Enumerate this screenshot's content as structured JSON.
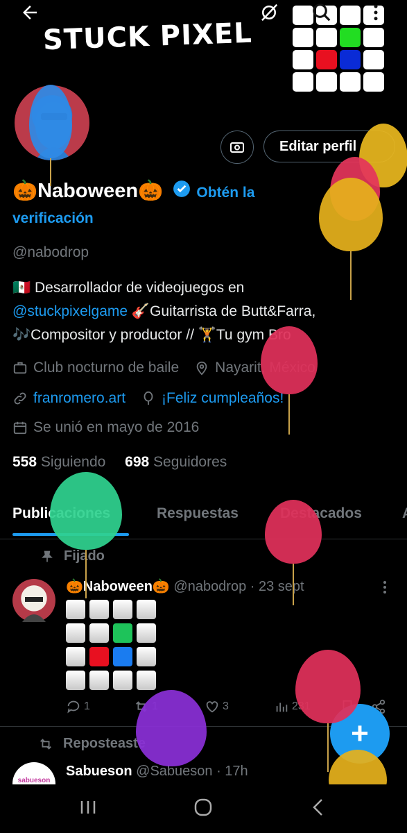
{
  "banner": {
    "title": "STUCK PIXEL",
    "grid_colors": [
      "#ffffff",
      "#ffffff",
      "#ffffff",
      "#ffffff",
      "#ffffff",
      "#ffffff",
      "#22dd22",
      "#ffffff",
      "#ffffff",
      "#e81020",
      "#0a2bd6",
      "#ffffff",
      "#ffffff",
      "#ffffff",
      "#ffffff",
      "#ffffff"
    ]
  },
  "top_icons": {
    "back": "back-arrow-icon",
    "no_wifi": "eye-slash-icon",
    "search": "search-icon",
    "more": "more-vertical-icon"
  },
  "profile": {
    "edit_label": "Editar perfil",
    "name": "🎃Naboween🎃",
    "verify_prefix": "Obtén la",
    "verify_suffix": "verificación",
    "handle": "@nabodrop",
    "bio_line1": "🇲🇽  Desarrollador de videojuegos en",
    "bio_mention": "@stuckpixelgame",
    "bio_line2": " 🎸Guitarrista de Butt&Farra,",
    "bio_line3": "🎶Compositor y productor // 🏋️Tu gym Bro",
    "category": "Club nocturno de baile",
    "location": "Nayarit, México",
    "website": "franromero.art",
    "birthday": "¡Feliz cumpleaños!",
    "joined": "Se unió en mayo de 2016",
    "following_count": "558",
    "following_label": "Siguiendo",
    "followers_count": "698",
    "followers_label": "Seguidores"
  },
  "tabs": [
    "Publicaciones",
    "Respuestas",
    "Destacados",
    "A"
  ],
  "pinned_post": {
    "pinned_label": "Fijado",
    "name": "🎃Naboween🎃",
    "handle": "@nabodrop",
    "date": "· 23 sept",
    "grid_colors": [
      "#ffffff",
      "#ffffff",
      "#ffffff",
      "#ffffff",
      "#ffffff",
      "#ffffff",
      "#1ec35a",
      "#ffffff",
      "#ffffff",
      "#e81020",
      "#1a7cf0",
      "#ffffff",
      "#ffffff",
      "#ffffff",
      "#ffffff",
      "#ffffff"
    ],
    "replies": "1",
    "reposts": "1",
    "likes": "3",
    "views": "231"
  },
  "repost_post": {
    "repost_label": "Reposteaste",
    "name": "Sabueson",
    "handle": "@Sabueson",
    "date": "· 17h",
    "avatar_text": "sabueson"
  },
  "fab_label": "+",
  "colors": {
    "accent": "#1d9bf0",
    "background": "#000000"
  }
}
